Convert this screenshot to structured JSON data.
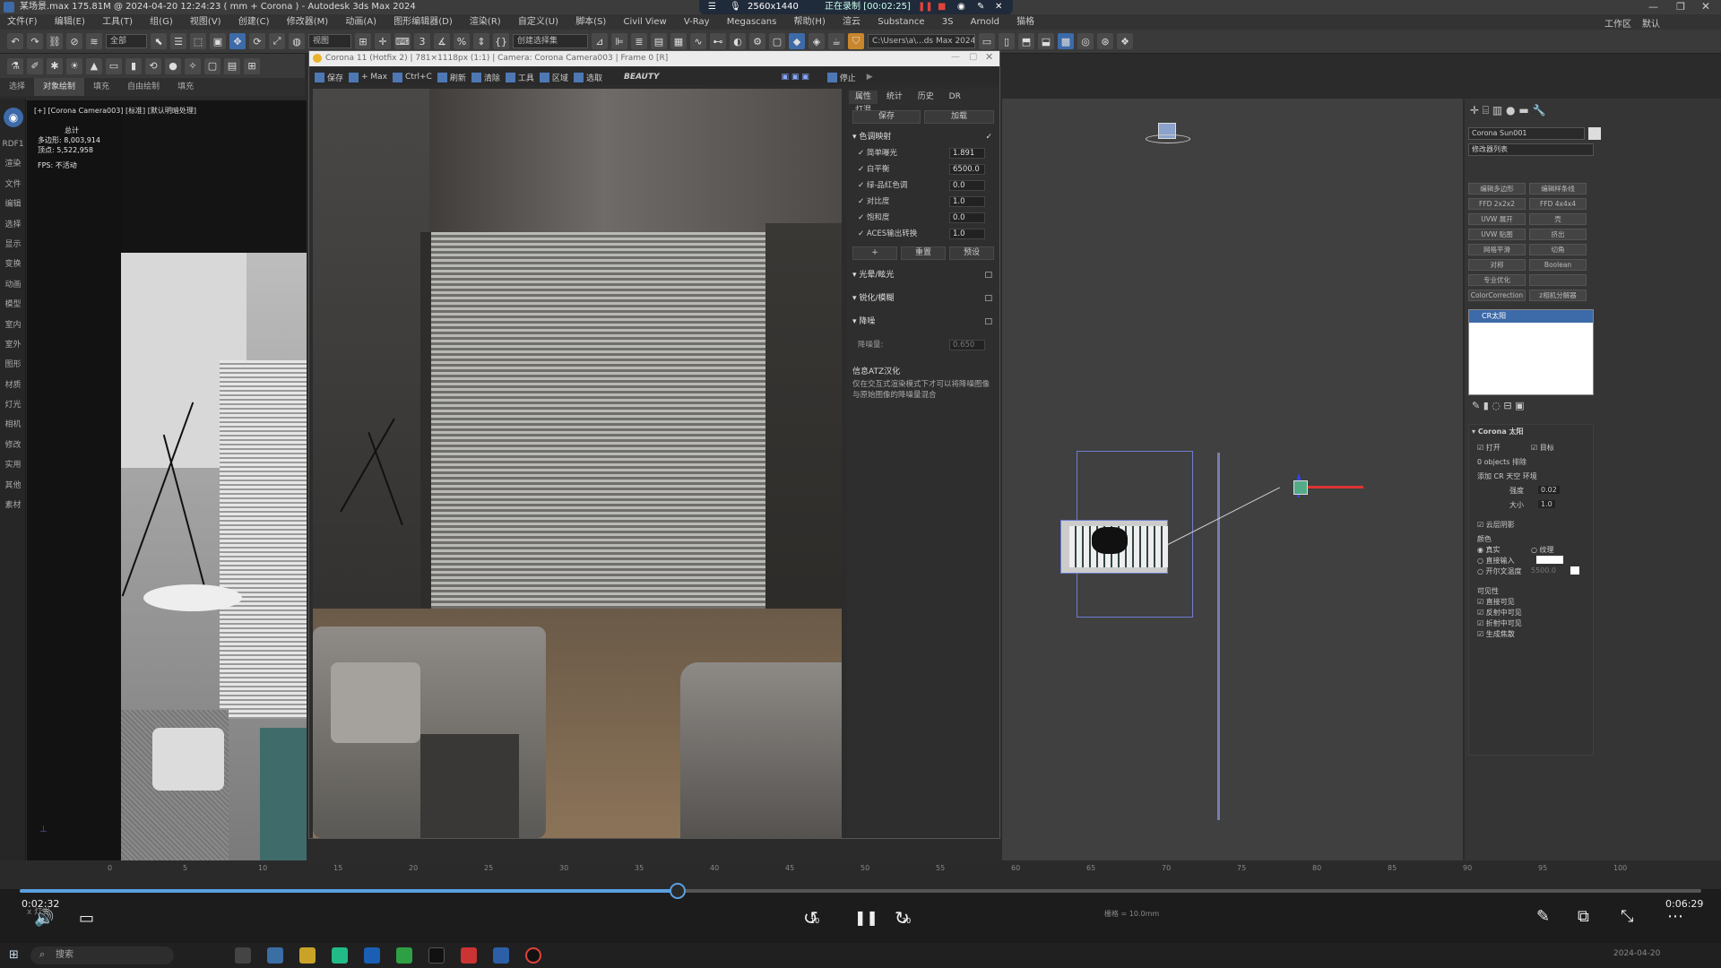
{
  "window": {
    "title": "某场景.max  175.81M @ 2024-04-20 12:24:23  ( mm + Corona ) - Autodesk 3ds Max 2024",
    "workspace_label": "工作区",
    "default_label": "默认"
  },
  "recorder": {
    "resolution": "2560x1440",
    "status": "正在录制 [00:02:25]"
  },
  "menu": [
    "文件(F)",
    "编辑(E)",
    "工具(T)",
    "组(G)",
    "视图(V)",
    "创建(C)",
    "修改器(M)",
    "动画(A)",
    "图形编辑器(D)",
    "渲染(R)",
    "自定义(U)",
    "脚本(S)",
    "Civil View",
    "V-Ray",
    "Megascans",
    "帮助(H)",
    "渲云",
    "Substance",
    "3S",
    "Arnold",
    "猫格"
  ],
  "toolbar": {
    "selection_filter": "全部",
    "view_dropdown": "视图",
    "selection_set": "创建选择集",
    "path": "C:\\Users\\a\\...ds Max 2024"
  },
  "subtabs": [
    "选择",
    "对象绘制",
    "填充",
    "自由绘制",
    "填充"
  ],
  "left_nav": [
    "渲染",
    "文件",
    "编辑",
    "选择",
    "显示",
    "变换",
    "动画",
    "模型",
    "室内",
    "室外",
    "图形",
    "材质",
    "灯光",
    "相机",
    "修改",
    "实用",
    "其他",
    "素材"
  ],
  "left_nav_top": "RDF1",
  "viewport_left": {
    "label": "[+] [Corona Camera003] [标准] [默认明暗处理]",
    "stats_header": "总计",
    "poly_label": "多边形:",
    "poly_value": "8,003,914",
    "vert_label": "顶点:",
    "vert_value": "5,522,958",
    "fps_label": "FPS:",
    "fps_value": "不活动"
  },
  "vfb": {
    "title": "Corona 11 (Hotfix 2) | 781×1118px (1:1) | Camera: Corona Camera003 | Frame 0 [R]",
    "toolbar": [
      "保存",
      "+ Max",
      "Ctrl+C",
      "刷新",
      "清除",
      "工具",
      "区域",
      "选取"
    ],
    "beauty": "BEAUTY",
    "stop": "停止",
    "panel_tabs": [
      "属性",
      "统计",
      "历史",
      "DR",
      "灯混"
    ],
    "save_btn": "保存",
    "load_btn": "加载",
    "section_tonemap": "色调映射",
    "params": [
      {
        "label": "简单曝光",
        "value": "1.891"
      },
      {
        "label": "白平衡",
        "value": "6500.0"
      },
      {
        "label": "绿-品红色调",
        "value": "0.0"
      },
      {
        "label": "对比度",
        "value": "1.0"
      },
      {
        "label": "饱和度",
        "value": "0.0"
      },
      {
        "label": "ACES输出转换",
        "value": "1.0"
      }
    ],
    "add_btn": "+",
    "reset_btn": "重置",
    "preset_btn": "预设",
    "section_bloom": "光晕/眩光",
    "section_sharpen": "锐化/模糊",
    "section_denoise": "降噪",
    "denoise_label": "降噪量:",
    "denoise_value": "0.650",
    "info_title": "信息ATZ汉化",
    "info_text": "仅在交互式渲染模式下才可以将降噪图像与原始图像的降噪量混合"
  },
  "cmdpanel": {
    "object_name": "Corona Sun001",
    "modifier_list": "修改器列表",
    "buttons": [
      "编辑多边形",
      "编辑样条线",
      "FFD 2x2x2",
      "FFD 4x4x4",
      "UVW 展开",
      "壳",
      "UVW 贴图",
      "挤出",
      "网格平滑",
      "切角",
      "对称",
      "Boolean",
      "专业优化",
      "",
      "ColorCorrection",
      "z相机分解器"
    ],
    "stack_item": "CR太阳",
    "rollout_title": "Corona 太阳",
    "on_label": "打开",
    "target_label": "目标",
    "objects_label": "0 objects 排除",
    "add_sky_label": "添加 CR 天空 环境",
    "intensity_label": "强度",
    "intensity_value": "0.02",
    "size_label": "大小",
    "size_value": "1.0",
    "cloud_label": "云层阴影",
    "color_label": "颜色",
    "color_opts": [
      "真实",
      "纹理",
      "直接输入",
      "开尔文温度"
    ],
    "kelvin_value": "5500.0",
    "visibility_label": "可见性",
    "vis_opts": [
      "直接可见",
      "反射中可见",
      "折射中可见",
      "生成焦散"
    ]
  },
  "timeline": {
    "ticks": [
      "0",
      "5",
      "10",
      "15",
      "20",
      "25",
      "30",
      "35",
      "40",
      "45",
      "50",
      "55",
      "60",
      "65",
      "70",
      "75",
      "80",
      "85",
      "90",
      "95",
      "100"
    ],
    "left_label": "x 灯光",
    "status": "栅格 = 10.0mm"
  },
  "player": {
    "current_time": "0:02:32",
    "total_time": "0:06:29",
    "progress": 0.391,
    "rewind_label": "10",
    "forward_label": "30"
  },
  "taskbar": {
    "search_placeholder": "搜索",
    "date": "2024-04-20"
  },
  "colors": {
    "accent": "#3d6aa8",
    "progress_blue": "#5aa0e0",
    "record_red": "#e0433a"
  }
}
